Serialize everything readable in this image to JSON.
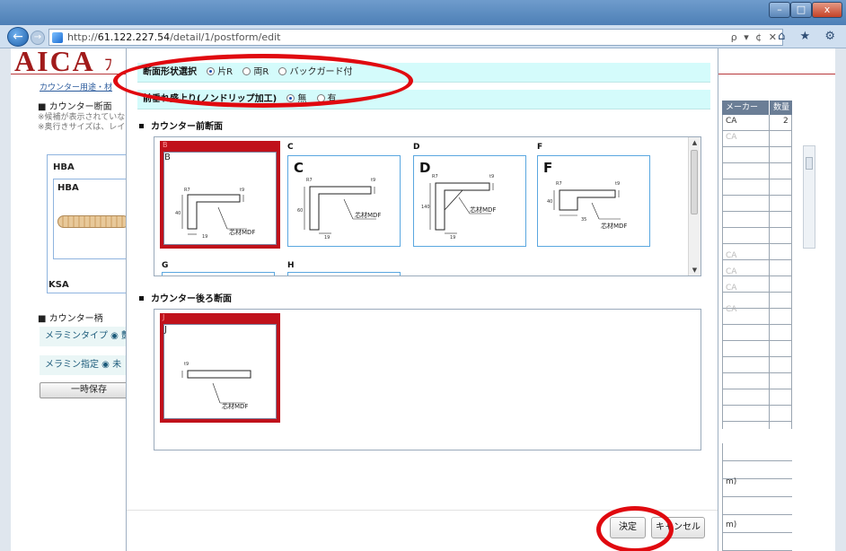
{
  "browser": {
    "url_prefix": "http://",
    "url_host": "61.122.227.54",
    "url_path": "/detail/1/postform/edit",
    "address_actions": "ρ ▾ ¢ ✕",
    "nav_icons": "⌂ ★ ⚙",
    "back_glyph": "←",
    "forward_glyph": "→",
    "window_controls": {
      "min": "–",
      "max": "□",
      "close": "x"
    }
  },
  "background_page": {
    "logo": "AICA",
    "logo_suffix": "ﾌ",
    "breadcrumb": "カウンター用途・材",
    "section_counter": "カウンター断面",
    "notes": [
      "※候補が表示されていな",
      "※奥行きサイズは、レイア"
    ],
    "panel_label": "HBA",
    "panel_inner_label": "HBA",
    "ksa_label": "KSA",
    "section_handle": "カウンター柄",
    "row_melamine_type": "メラミンタイプ ◉ 艶",
    "row_melamine_spec": "メラミン指定 ◉ 未",
    "temp_save_button": "一時保存",
    "table_headers": [
      "メーカー",
      "数量"
    ],
    "table_cells": [
      "CA",
      "2",
      "CA",
      "CA",
      "CA",
      "CA",
      "CA"
    ],
    "lower_cells": [
      "m)",
      "m)"
    ]
  },
  "dialog": {
    "shape_select": {
      "title": "断面形状選択",
      "options": [
        "片R",
        "両R",
        "バックガード付"
      ],
      "selected": 0
    },
    "drip_edge": {
      "title": "前垂れ盛上り(ノンドリップ加工)",
      "options": [
        "無",
        "有"
      ],
      "selected": 0
    },
    "front_section": {
      "title": "カウンター前断面",
      "tiles": [
        {
          "caption": "B",
          "letter": "B",
          "material": "芯材MDF",
          "dims": [
            "R7",
            "t9",
            "40",
            "19"
          ]
        },
        {
          "caption": "C",
          "letter": "C",
          "material": "芯材MDF",
          "dims": [
            "R7",
            "t9",
            "60",
            "19"
          ]
        },
        {
          "caption": "D",
          "letter": "D",
          "material": "芯材MDF",
          "dims": [
            "R7",
            "t9",
            "140",
            "19"
          ]
        },
        {
          "caption": "F",
          "letter": "F",
          "material": "芯材MDF",
          "dims": [
            "R7",
            "t9",
            "40",
            "35"
          ]
        },
        {
          "caption": "G"
        },
        {
          "caption": "H"
        }
      ],
      "selected": 0
    },
    "back_section": {
      "title": "カウンター後ろ断面",
      "tiles": [
        {
          "caption": "J",
          "letter": "J",
          "material": "芯材MDF",
          "dims": [
            "t9"
          ]
        }
      ],
      "selected": 0
    },
    "buttons": {
      "confirm": "決定",
      "cancel": "キャンセル"
    }
  },
  "colors": {
    "selection_red": "#c0111b",
    "option_row_bg": "#d4fbfb",
    "annotation_red": "#e0090f",
    "tile_border_blue": "#5aa7e0"
  }
}
